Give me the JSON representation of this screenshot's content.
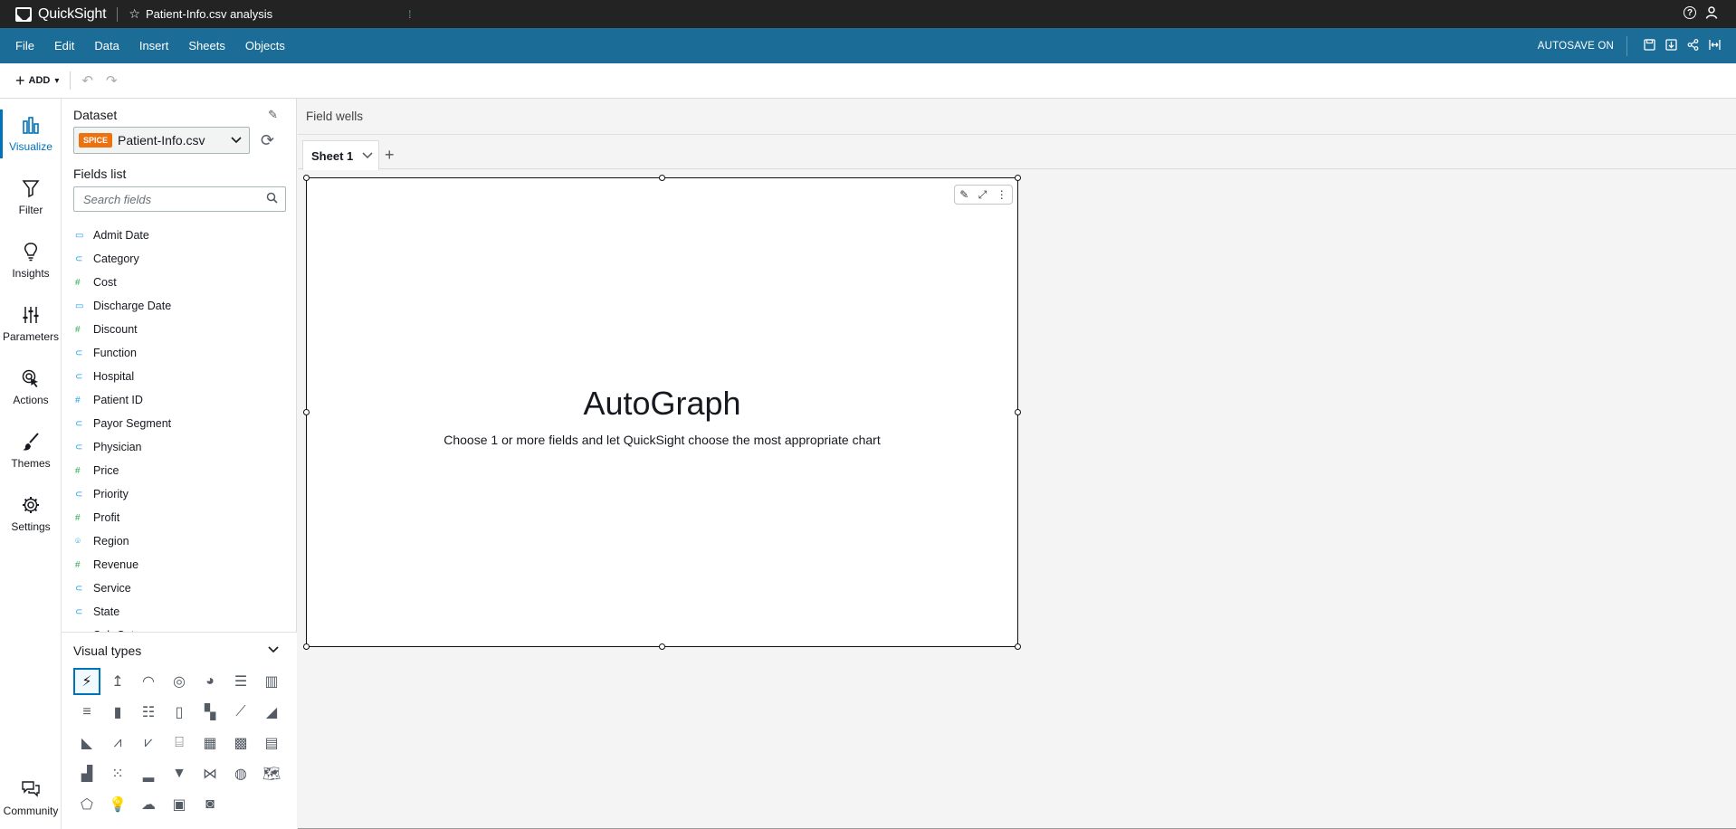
{
  "titlebar": {
    "app_name": "QuickSight",
    "analysis_title": "Patient-Info.csv analysis"
  },
  "menu": {
    "items": [
      "File",
      "Edit",
      "Data",
      "Insert",
      "Sheets",
      "Objects"
    ],
    "autosave": "AUTOSAVE ON"
  },
  "toolbar": {
    "add_label": "ADD"
  },
  "rail": {
    "items": [
      "Visualize",
      "Filter",
      "Insights",
      "Parameters",
      "Actions",
      "Themes",
      "Settings"
    ],
    "community": "Community"
  },
  "panel": {
    "dataset_heading": "Dataset",
    "spice_badge": "SPICE",
    "dataset_name": "Patient-Info.csv",
    "fields_heading": "Fields list",
    "search_placeholder": "Search fields",
    "fields": [
      {
        "name": "Admit Date",
        "type": "date"
      },
      {
        "name": "Category",
        "type": "dimension"
      },
      {
        "name": "Cost",
        "type": "measure"
      },
      {
        "name": "Discharge Date",
        "type": "date"
      },
      {
        "name": "Discount",
        "type": "measure"
      },
      {
        "name": "Function",
        "type": "dimension"
      },
      {
        "name": "Hospital",
        "type": "dimension"
      },
      {
        "name": "Patient ID",
        "type": "measure-dim"
      },
      {
        "name": "Payor Segment",
        "type": "dimension"
      },
      {
        "name": "Physician",
        "type": "dimension"
      },
      {
        "name": "Price",
        "type": "measure"
      },
      {
        "name": "Priority",
        "type": "dimension"
      },
      {
        "name": "Profit",
        "type": "measure"
      },
      {
        "name": "Region",
        "type": "geo"
      },
      {
        "name": "Revenue",
        "type": "measure"
      },
      {
        "name": "Service",
        "type": "dimension"
      },
      {
        "name": "State",
        "type": "dimension"
      },
      {
        "name": "Sub Cat",
        "type": "dimension"
      }
    ],
    "visual_types_heading": "Visual types"
  },
  "main": {
    "field_wells": "Field wells",
    "sheet_tab": "Sheet 1",
    "autograph_title": "AutoGraph",
    "autograph_subtitle": "Choose 1 or more fields and let QuickSight choose the most appropriate chart"
  },
  "colors": {
    "titlebar": "#232323",
    "menubar": "#1b6d98",
    "accent": "#0073bb",
    "spice": "#ec7211",
    "measure_icon": "#2ea44f",
    "dimension_icon": "#1a9ee3"
  }
}
